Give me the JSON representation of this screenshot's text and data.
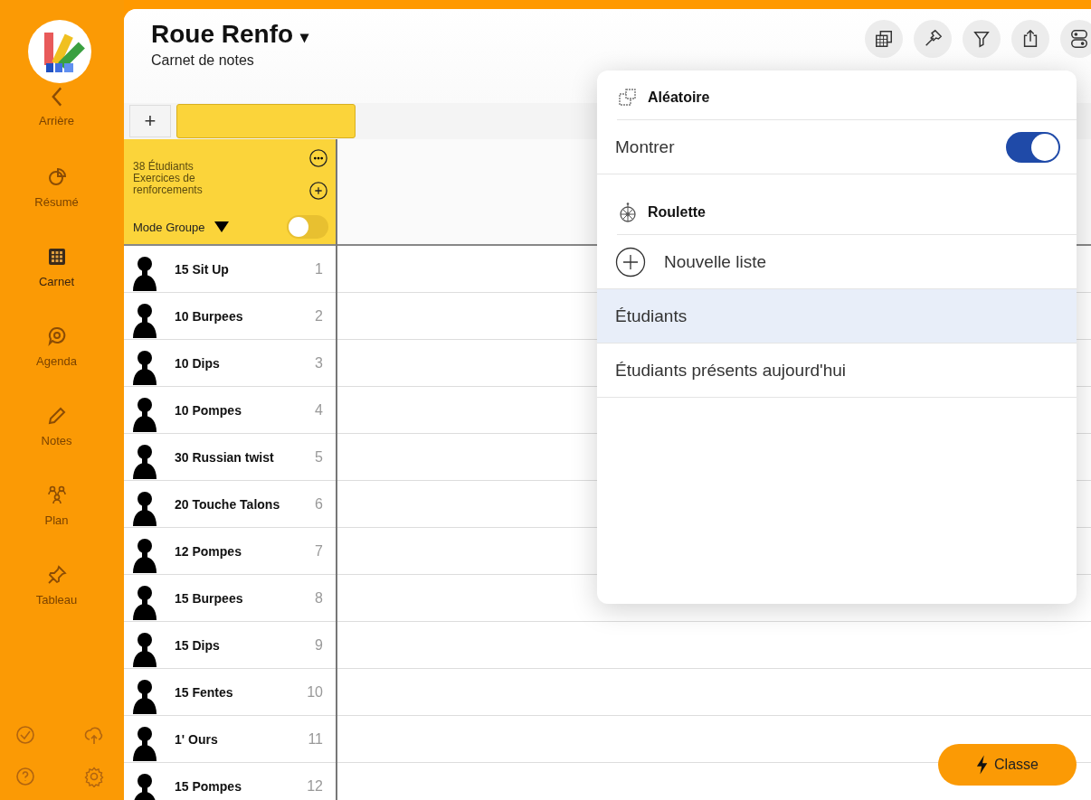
{
  "sidebar": {
    "items": [
      {
        "kind": "back",
        "label": "Arrière",
        "selected": false
      },
      {
        "kind": "summary",
        "label": "Résumé",
        "selected": false
      },
      {
        "kind": "grid",
        "label": "Carnet",
        "selected": true
      },
      {
        "kind": "agenda",
        "label": "Agenda",
        "selected": false
      },
      {
        "kind": "notes",
        "label": "Notes",
        "selected": false
      },
      {
        "kind": "plan",
        "label": "Plan",
        "selected": false
      },
      {
        "kind": "pin",
        "label": "Tableau",
        "selected": false
      }
    ]
  },
  "header": {
    "title": "Roue Renfo",
    "title_caret": "▾",
    "subtitle": "Carnet de notes"
  },
  "toolbar": {
    "add": "+"
  },
  "group_card": {
    "count": "38 Étudiants",
    "description": "Exercices de renforcements",
    "mode_label": "Mode Groupe",
    "mode_on": false
  },
  "rows": [
    {
      "name": "15 Sit Up",
      "number": "1"
    },
    {
      "name": "10 Burpees",
      "number": "2"
    },
    {
      "name": "10 Dips",
      "number": "3"
    },
    {
      "name": "10 Pompes",
      "number": "4"
    },
    {
      "name": "30 Russian twist",
      "number": "5"
    },
    {
      "name": "20 Touche Talons",
      "number": "6"
    },
    {
      "name": "12 Pompes",
      "number": "7"
    },
    {
      "name": "15 Burpees",
      "number": "8"
    },
    {
      "name": "15 Dips",
      "number": "9"
    },
    {
      "name": "15 Fentes",
      "number": "10"
    },
    {
      "name": "1' Ours",
      "number": "11"
    },
    {
      "name": "15 Pompes",
      "number": "12"
    }
  ],
  "popover": {
    "random_title": "Aléatoire",
    "show_label": "Montrer",
    "show_on": true,
    "roulette_title": "Roulette",
    "new_list": "Nouvelle liste",
    "lists": [
      {
        "label": "Étudiants",
        "selected": true
      },
      {
        "label": "Étudiants présents aujourd'hui",
        "selected": false
      }
    ]
  },
  "action_button": {
    "label": "Classe"
  }
}
